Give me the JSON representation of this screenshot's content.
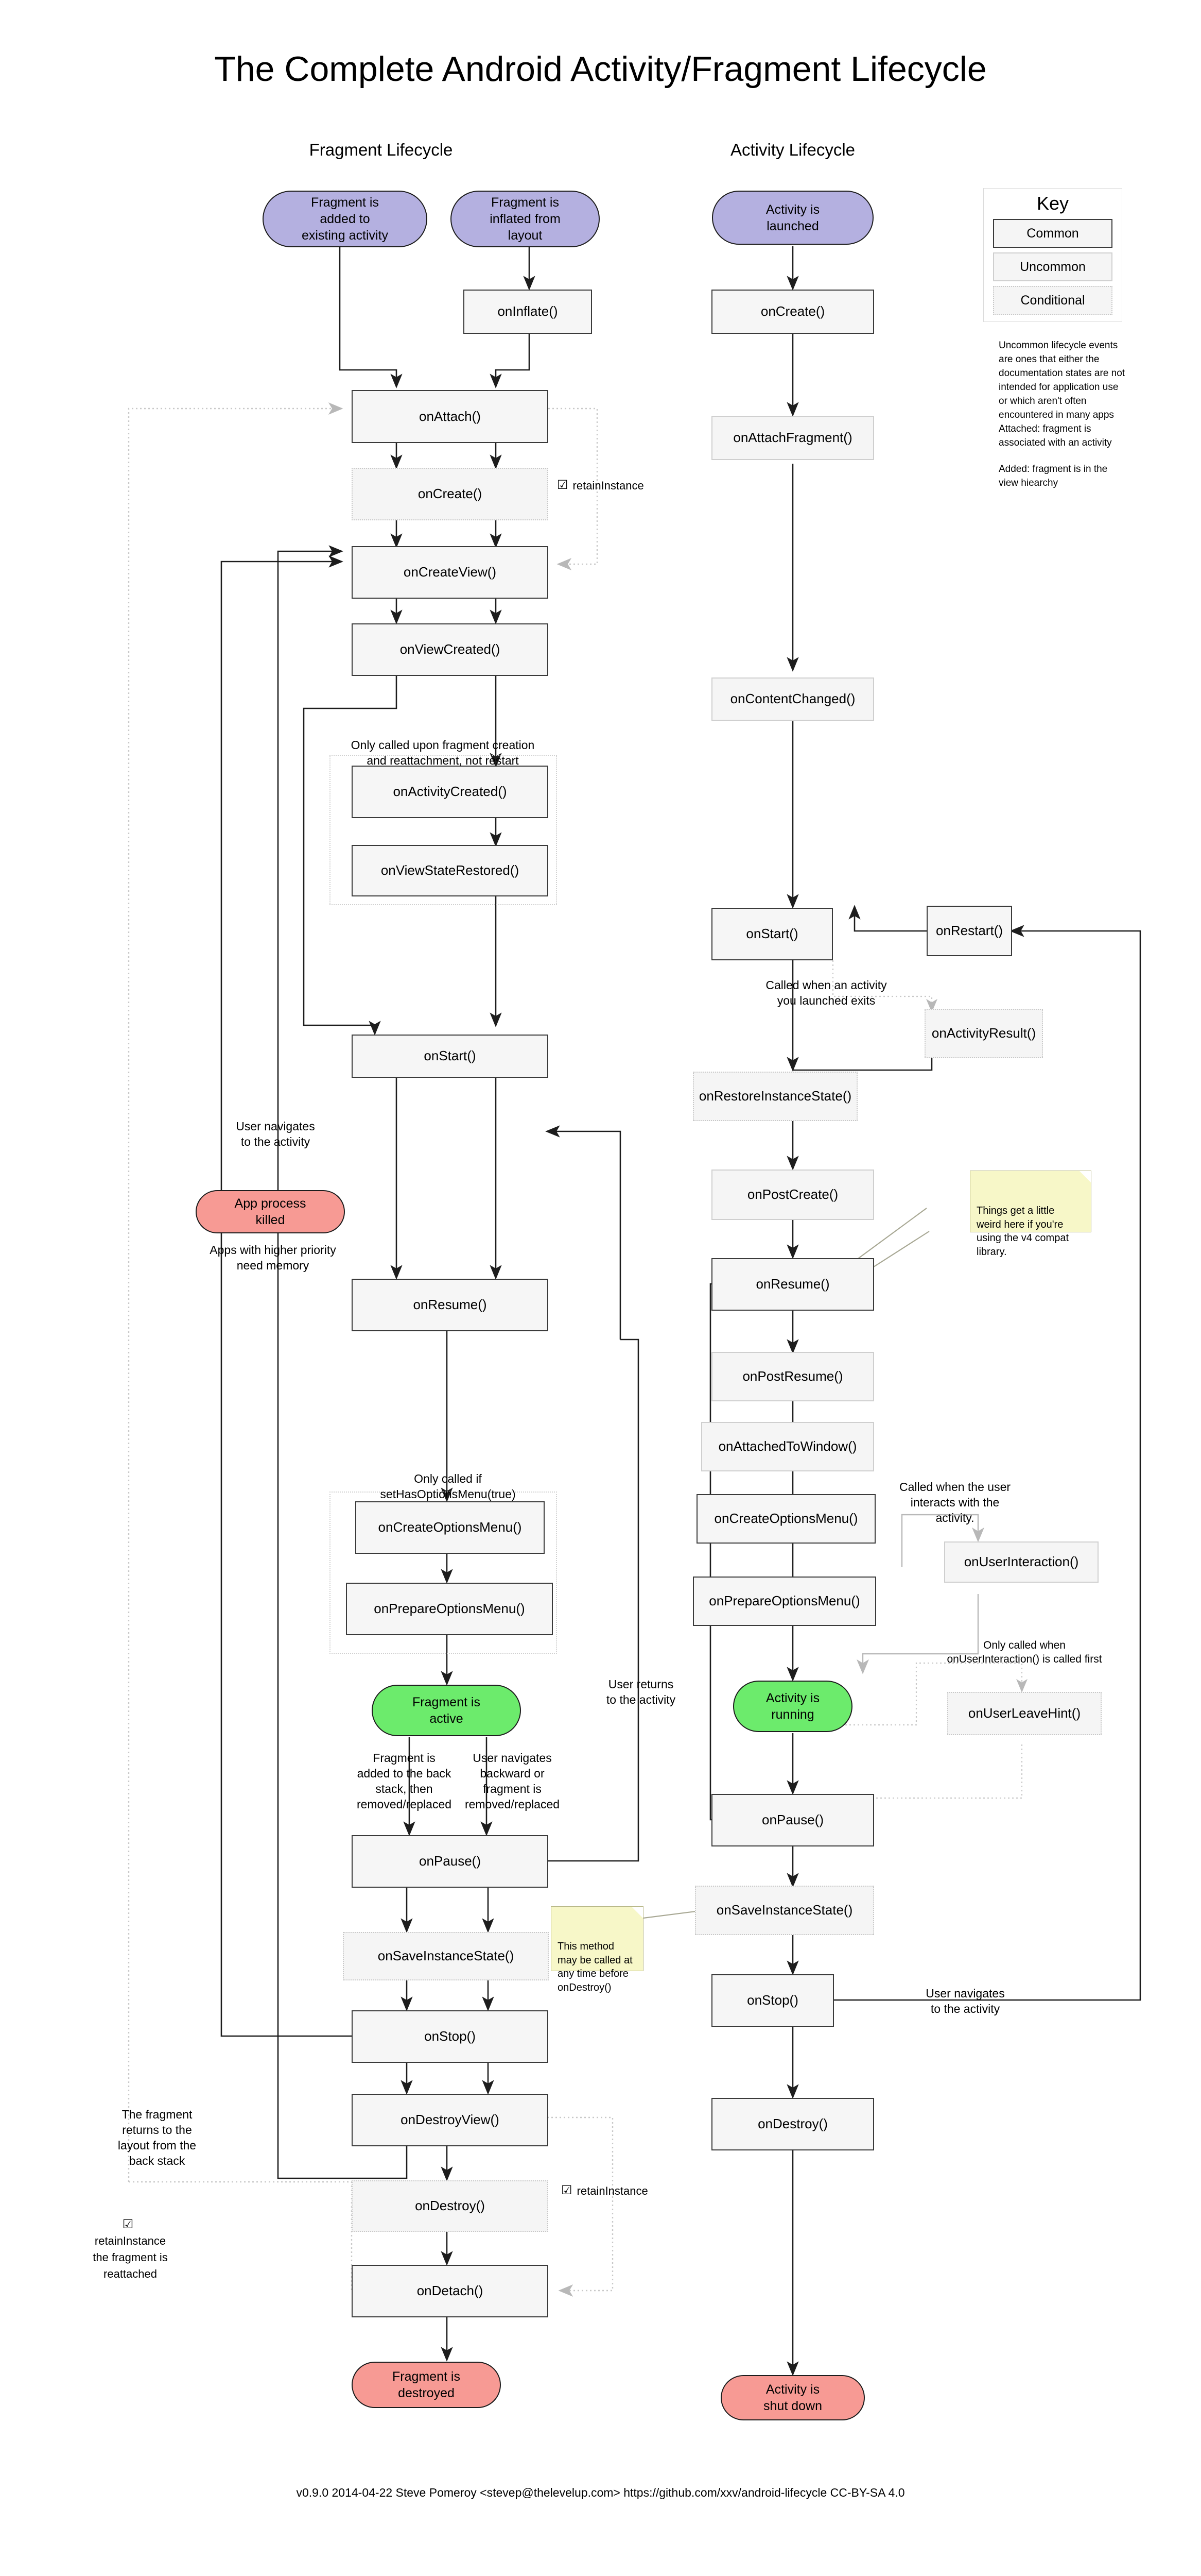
{
  "title": "The Complete Android Activity/Fragment Lifecycle",
  "columns": {
    "fragment": "Fragment Lifecycle",
    "activity": "Activity Lifecycle"
  },
  "footer": "v0.9.0 2014-04-22 Steve Pomeroy <stevep@thelevelup.com> https://github.com/xxv/android-lifecycle CC-BY-SA 4.0",
  "key": {
    "heading": "Key",
    "rows": [
      {
        "label": "Common",
        "kind": "common"
      },
      {
        "label": "Uncommon",
        "kind": "uncommon"
      },
      {
        "label": "Conditional",
        "kind": "conditional"
      }
    ],
    "notes": [
      "Uncommon lifecycle events are ones that either the documentation states are not intended for application use or which aren't often encountered in many apps",
      "Attached: fragment is associated with an activity",
      "Added: fragment is in the view hiearchy"
    ]
  },
  "colors": {
    "start": "#b4b0e0",
    "active": "#6ceb6c",
    "end": "#f79a94",
    "sticky": "#f7f7c8",
    "common_border": "#3a3a3a",
    "uncommon_border": "#cfcfcf",
    "conditional_border": "#c8c8c8",
    "wire": "#1d1d1d",
    "wire_light": "#b8b8b8",
    "node_fill": "#f5f5f5"
  },
  "fragment_nodes": {
    "added_to_activity": "Fragment is\nadded to\nexisting activity",
    "inflated_from_layout": "Fragment is\ninflated from\nlayout",
    "on_inflate": "onInflate()",
    "on_attach": "onAttach()",
    "on_create": "onCreate()",
    "on_create_view": "onCreateView()",
    "on_view_created": "onViewCreated()",
    "on_activity_created": "onActivityCreated()",
    "on_view_state_restored": "onViewStateRestored()",
    "on_start": "onStart()",
    "on_resume": "onResume()",
    "on_create_options_menu": "onCreateOptionsMenu()",
    "on_prepare_options_menu": "onPrepareOptionsMenu()",
    "fragment_active": "Fragment is\nactive",
    "on_pause": "onPause()",
    "on_save_instance_state": "onSaveInstanceState()",
    "on_stop": "onStop()",
    "on_destroy_view": "onDestroyView()",
    "on_destroy": "onDestroy()",
    "on_detach": "onDetach()",
    "fragment_destroyed": "Fragment is\ndestroyed",
    "app_process_killed": "App process\nkilled"
  },
  "activity_nodes": {
    "activity_launched": "Activity is\nlaunched",
    "on_create": "onCreate()",
    "on_attach_fragment": "onAttachFragment()",
    "on_content_changed": "onContentChanged()",
    "on_start": "onStart()",
    "on_restart": "onRestart()",
    "on_activity_result": "onActivityResult()",
    "on_restore_instance_state": "onRestoreInstanceState()",
    "on_post_create": "onPostCreate()",
    "on_resume": "onResume()",
    "on_post_resume": "onPostResume()",
    "on_attached_to_window": "onAttachedToWindow()",
    "on_create_options_menu": "onCreateOptionsMenu()",
    "on_prepare_options_menu": "onPrepareOptionsMenu()",
    "on_user_interaction": "onUserInteraction()",
    "on_user_leave_hint": "onUserLeaveHint()",
    "activity_running": "Activity is\nrunning",
    "on_pause": "onPause()",
    "on_save_instance_state": "onSaveInstanceState()",
    "on_stop": "onStop()",
    "on_destroy": "onDestroy()",
    "activity_shut_down": "Activity is\nshut down"
  },
  "labels": {
    "retain_instance_attach": "retainInstance",
    "retain_instance_destroy": "retainInstance",
    "only_called_creation": "Only called upon fragment creation\nand reattachment, not restart",
    "user_navigates_to_activity_frag": "User navigates\nto the activity",
    "apps_higher_priority": "Apps with higher priority\nneed memory",
    "only_called_sethasoptionsmenu": "Only called if\nsetHasOptionsMenu(true)",
    "fragment_backstack": "Fragment is\nadded to the back\nstack, then\nremoved/replaced",
    "user_navigates_backward": "User navigates\nbackward or\nfragment is\nremoved/replaced",
    "user_returns_to_activity": "User returns\nto the activity",
    "fragment_returns_layout": "The fragment\nreturns to the\nlayout from the\nback stack",
    "retain_instance_reattached": "retainInstance\nthe fragment is\nreattached",
    "called_when_activity_exits": "Called when an activity\nyou launched exits",
    "called_when_user_interacts": "Called when the user\ninteracts with the\nactivity.",
    "only_called_on_user_interaction": "Only called when\nonUserInteraction() is called first",
    "user_navigates_to_activity_act": "User navigates\nto the activity"
  },
  "sticky_notes": {
    "v4_compat": "Things get a little\nweird here if you're\nusing the v4 compat\nlibrary.",
    "on_save_any_time": "This method\nmay be called at\nany time before\nonDestroy()"
  },
  "icons": {
    "checkbox_checked": "☑"
  }
}
